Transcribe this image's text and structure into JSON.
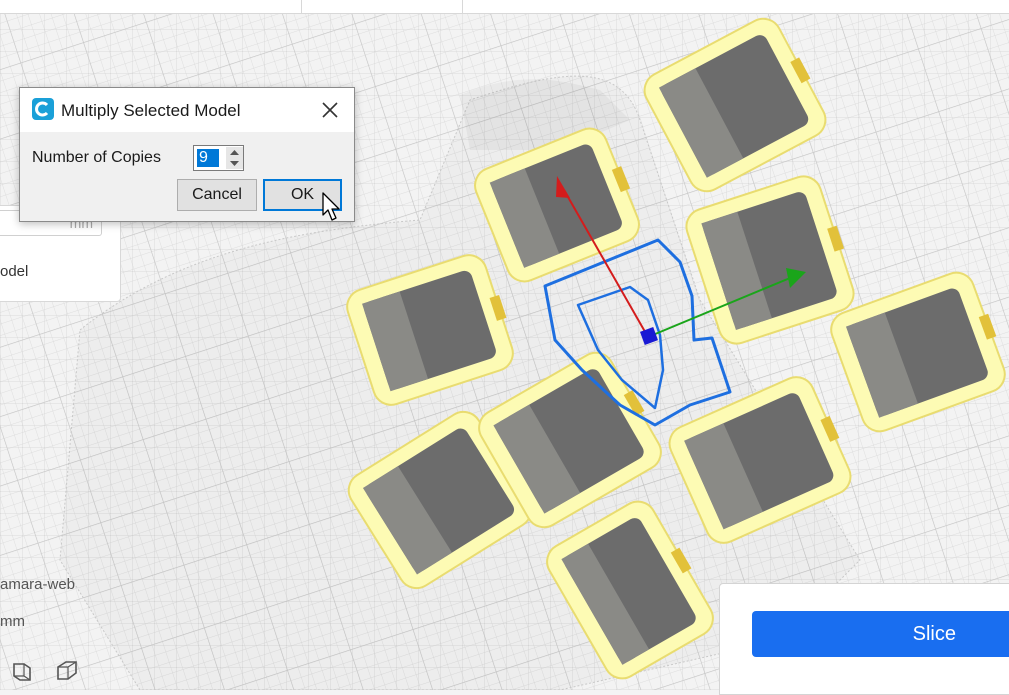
{
  "dialog": {
    "title": "Multiply Selected Model",
    "copies_label": "Number of Copies",
    "copies_value": "9",
    "cancel_label": "Cancel",
    "ok_label": "OK"
  },
  "side_panel": {
    "unit": "mm",
    "model_label": "odel"
  },
  "bottom_left": {
    "object_name": "amara-web",
    "dimension_unit": "mm"
  },
  "slice_panel": {
    "slice_label": "Slice"
  },
  "colors": {
    "accent": "#196ef0",
    "model_fill": "#fdfbb4",
    "model_shadow": "#6c6c6c",
    "selection_outline": "#1e6fe0",
    "axis_x": "#d41c1c",
    "axis_y": "#1aa51a",
    "axis_z": "#1a1ad4"
  },
  "icons": [
    "cura-app-icon",
    "close-icon",
    "spin-up-icon",
    "spin-down-icon",
    "view-side-icon",
    "view-3d-icon",
    "mouse-cursor-icon"
  ]
}
